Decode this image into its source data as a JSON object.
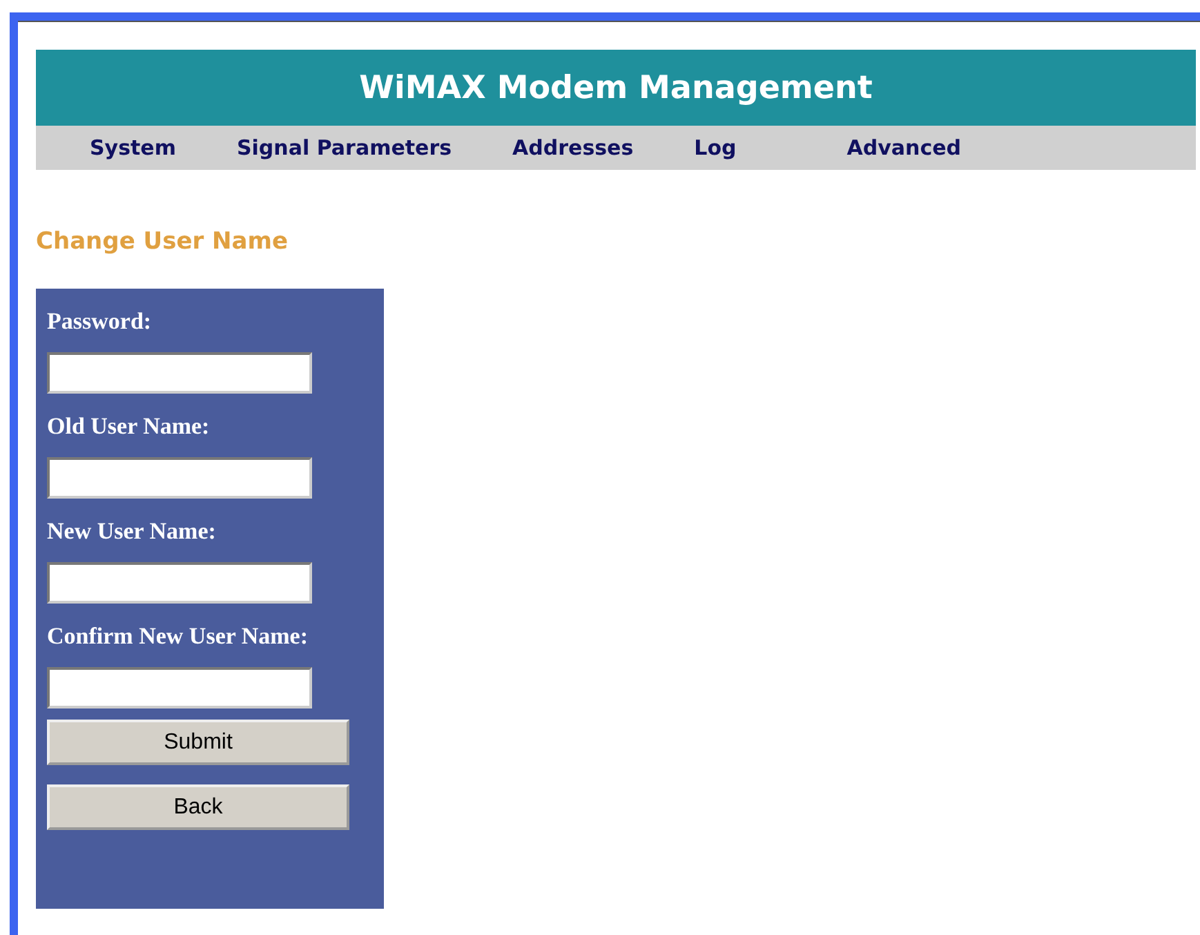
{
  "header": {
    "title": "WiMAX Modem Management"
  },
  "nav": [
    {
      "label": "System"
    },
    {
      "label": "Signal Parameters"
    },
    {
      "label": "Addresses"
    },
    {
      "label": "Log"
    },
    {
      "label": "Advanced"
    }
  ],
  "page_title": "Change User Name",
  "form": {
    "fields": [
      {
        "label": "Password:"
      },
      {
        "label": "Old User Name:"
      },
      {
        "label": "New User Name:"
      },
      {
        "label": "Confirm New User Name:"
      }
    ],
    "buttons": [
      "Submit",
      "Back"
    ]
  }
}
